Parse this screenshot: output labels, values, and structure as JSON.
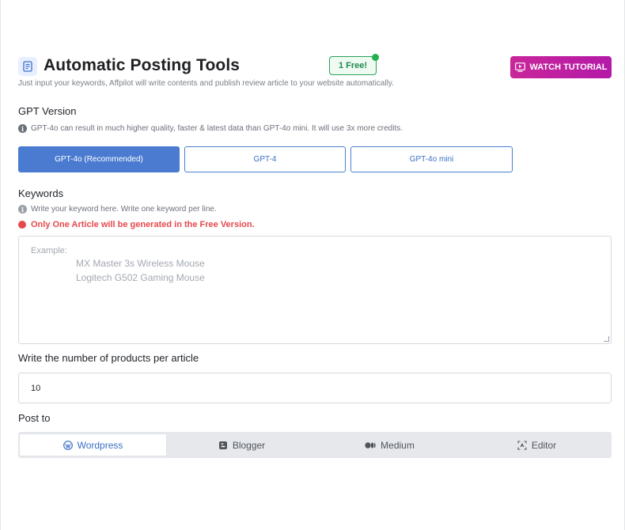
{
  "header": {
    "title": "Automatic Posting Tools",
    "title_icon": "document-list-icon",
    "badge": "1 Free!",
    "watch_button": "WATCH TUTORIAL",
    "watch_icon": "play-screen-icon",
    "subtitle": "Just input your keywords, Affpilot will write contents and publish review article to your website automatically.",
    "accent_color": "#c01ea0"
  },
  "gpt": {
    "label": "GPT Version",
    "info": "GPT-4o can result in much higher quality, faster & latest data than GPT-4o mini. It will use 3x more credits.",
    "options": [
      {
        "label": "GPT-4o (Recommended)",
        "selected": true
      },
      {
        "label": "GPT-4",
        "selected": false
      },
      {
        "label": "GPT-4o mini",
        "selected": false
      }
    ],
    "active_color": "#4a7bd0"
  },
  "keywords": {
    "label": "Keywords",
    "info": "Write your keyword here. Write one keyword per line.",
    "warning": "Only One Article will be generated in the Free Version.",
    "warning_color": "#e5484d",
    "placeholder_label": "Example:",
    "placeholder_lines": [
      "MX Master 3s Wireless Mouse",
      "Logitech G502 Gaming Mouse"
    ]
  },
  "products": {
    "label": "Write the number of products per article",
    "value": "10"
  },
  "post_to": {
    "label": "Post to",
    "tabs": [
      {
        "label": "Wordpress",
        "icon": "wordpress-icon",
        "active": true
      },
      {
        "label": "Blogger",
        "icon": "blogger-icon",
        "active": false
      },
      {
        "label": "Medium",
        "icon": "medium-icon",
        "active": false
      },
      {
        "label": "Editor",
        "icon": "editor-icon",
        "active": false
      }
    ]
  }
}
